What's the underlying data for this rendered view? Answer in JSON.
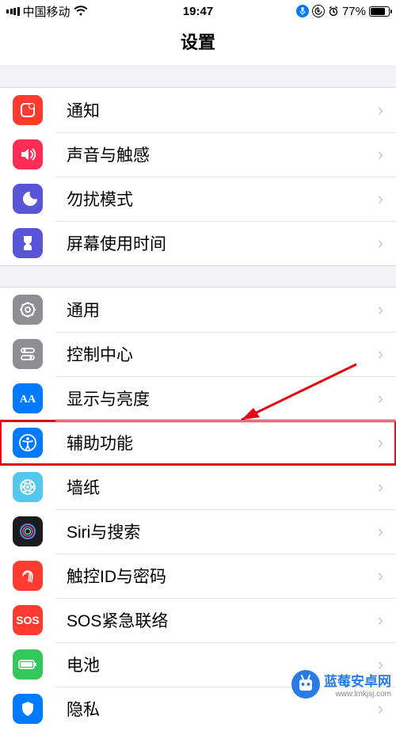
{
  "status": {
    "carrier": "中国移动",
    "time": "19:47",
    "battery": "77%"
  },
  "nav": {
    "title": "设置"
  },
  "group1": [
    {
      "id": "notifications",
      "label": "通知",
      "icon": "notifications-icon",
      "bg": "#ff3b30"
    },
    {
      "id": "sounds",
      "label": "声音与触感",
      "icon": "sounds-icon",
      "bg": "#ff3b30"
    },
    {
      "id": "dnd",
      "label": "勿扰模式",
      "icon": "dnd-icon",
      "bg": "#5856d6"
    },
    {
      "id": "screentime",
      "label": "屏幕使用时间",
      "icon": "screentime-icon",
      "bg": "#5856d6"
    }
  ],
  "group2": [
    {
      "id": "general",
      "label": "通用",
      "icon": "general-icon",
      "bg": "#8e8e93"
    },
    {
      "id": "control-center",
      "label": "控制中心",
      "icon": "control-center-icon",
      "bg": "#8e8e93"
    },
    {
      "id": "display",
      "label": "显示与亮度",
      "icon": "display-icon",
      "bg": "#007aff"
    },
    {
      "id": "accessibility",
      "label": "辅助功能",
      "icon": "accessibility-icon",
      "bg": "#007aff",
      "highlighted": true
    },
    {
      "id": "wallpaper",
      "label": "墙纸",
      "icon": "wallpaper-icon",
      "bg": "#54c7ec"
    },
    {
      "id": "siri",
      "label": "Siri与搜索",
      "icon": "siri-icon",
      "bg": "#1c1c1e"
    },
    {
      "id": "touchid",
      "label": "触控ID与密码",
      "icon": "touchid-icon",
      "bg": "#ff3b30"
    },
    {
      "id": "sos",
      "label": "SOS紧急联络",
      "icon": "sos-icon",
      "bg": "#ff3b30",
      "text": "SOS"
    },
    {
      "id": "battery",
      "label": "电池",
      "icon": "battery-icon",
      "bg": "#34c759"
    },
    {
      "id": "privacy",
      "label": "隐私",
      "icon": "privacy-icon",
      "bg": "#007aff"
    }
  ],
  "watermark": {
    "text": "蓝莓安卓网",
    "sub": "www.lmkjsj.com"
  }
}
